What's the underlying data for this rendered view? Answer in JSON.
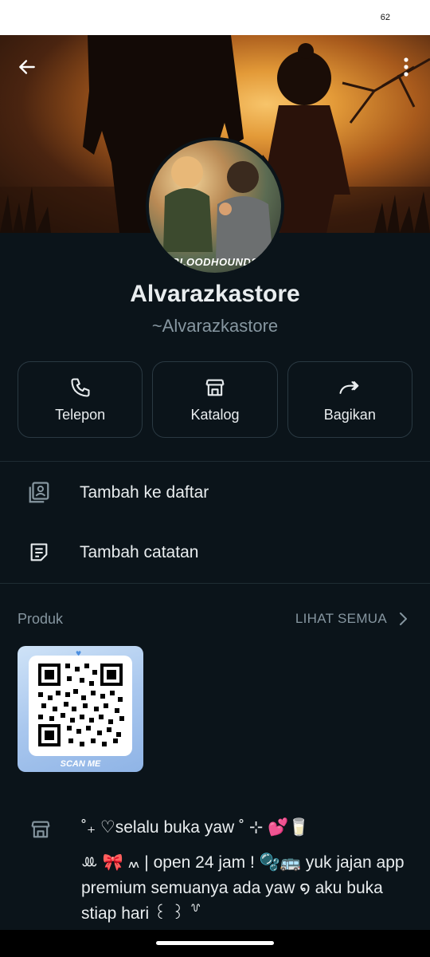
{
  "status": {
    "battery": "62"
  },
  "header": {
    "back_icon": "arrow-left-icon",
    "menu_icon": "more-vertical-icon"
  },
  "profile": {
    "name": "Alvarazkastore",
    "handle": "~Alvarazkastore",
    "avatar_caption": "BLOODHOUNDS"
  },
  "actions": [
    {
      "label": "Telepon",
      "icon": "phone-icon"
    },
    {
      "label": "Katalog",
      "icon": "store-icon"
    },
    {
      "label": "Bagikan",
      "icon": "share-icon"
    }
  ],
  "menu": [
    {
      "label": "Tambah ke daftar",
      "icon": "contact-list-icon"
    },
    {
      "label": "Tambah catatan",
      "icon": "note-icon"
    }
  ],
  "products": {
    "title": "Produk",
    "see_all": "LIHAT SEMUA",
    "items": [
      {
        "caption": "SCAN ME"
      }
    ]
  },
  "bio": {
    "line1": "˚₊ ♡selalu buka yaw ˚ ⊹ 💕🥛",
    "line2": "ꔛ 🎀 ៳ | open 24 jam ! 🫧🚌 yuk jajan app premium semuanya ada yaw ໑ aku buka stiap hari ꒰ ꒱ ꒷"
  },
  "colors": {
    "background": "#0b141a",
    "border": "#2a3942",
    "muted": "#8696a0",
    "text": "#e9edef"
  }
}
